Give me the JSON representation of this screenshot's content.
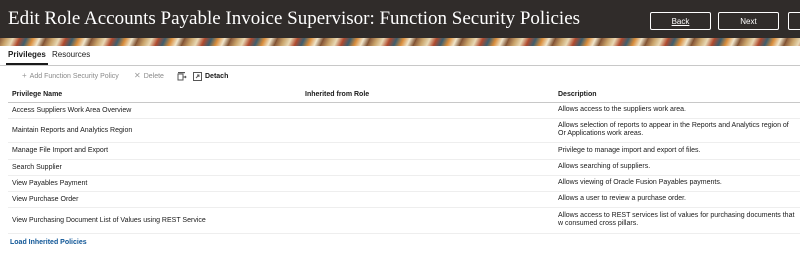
{
  "header": {
    "title": "Edit Role Accounts Payable Invoice Supervisor: Function Security Policies",
    "back_label": "Back",
    "next_label": "Next"
  },
  "tabs": [
    {
      "label": "Privileges",
      "selected": true
    },
    {
      "label": "Resources",
      "selected": false
    }
  ],
  "toolbar": {
    "add_label": "Add Function Security Policy",
    "delete_label": "Delete",
    "detach_label": "Detach"
  },
  "table": {
    "columns": [
      "Privilege Name",
      "Inherited from Role",
      "Description"
    ],
    "rows": [
      {
        "name": "Access Suppliers Work Area Overview",
        "inherited": "",
        "description": "Allows access to the suppliers work area."
      },
      {
        "name": "Maintain Reports and Analytics Region",
        "inherited": "",
        "description": "Allows selection of reports to appear in the Reports and Analytics region of Or Applications work areas."
      },
      {
        "name": "Manage File Import and Export",
        "inherited": "",
        "description": "Privilege to manage import and export of files."
      },
      {
        "name": "Search Supplier",
        "inherited": "",
        "description": "Allows searching of suppliers."
      },
      {
        "name": "View Payables Payment",
        "inherited": "",
        "description": "Allows viewing of Oracle Fusion Payables payments."
      },
      {
        "name": "View Purchase Order",
        "inherited": "",
        "description": "Allows a user to review a purchase order."
      },
      {
        "name": "View Purchasing Document List of Values using REST Service",
        "inherited": "",
        "description": "Allows access to REST services list of values for purchasing documents that w consumed cross pillars."
      }
    ]
  },
  "footer": {
    "load_link": "Load Inherited Policies"
  },
  "colors": {
    "header_bg": "#302c2a",
    "link": "#0e5596"
  }
}
